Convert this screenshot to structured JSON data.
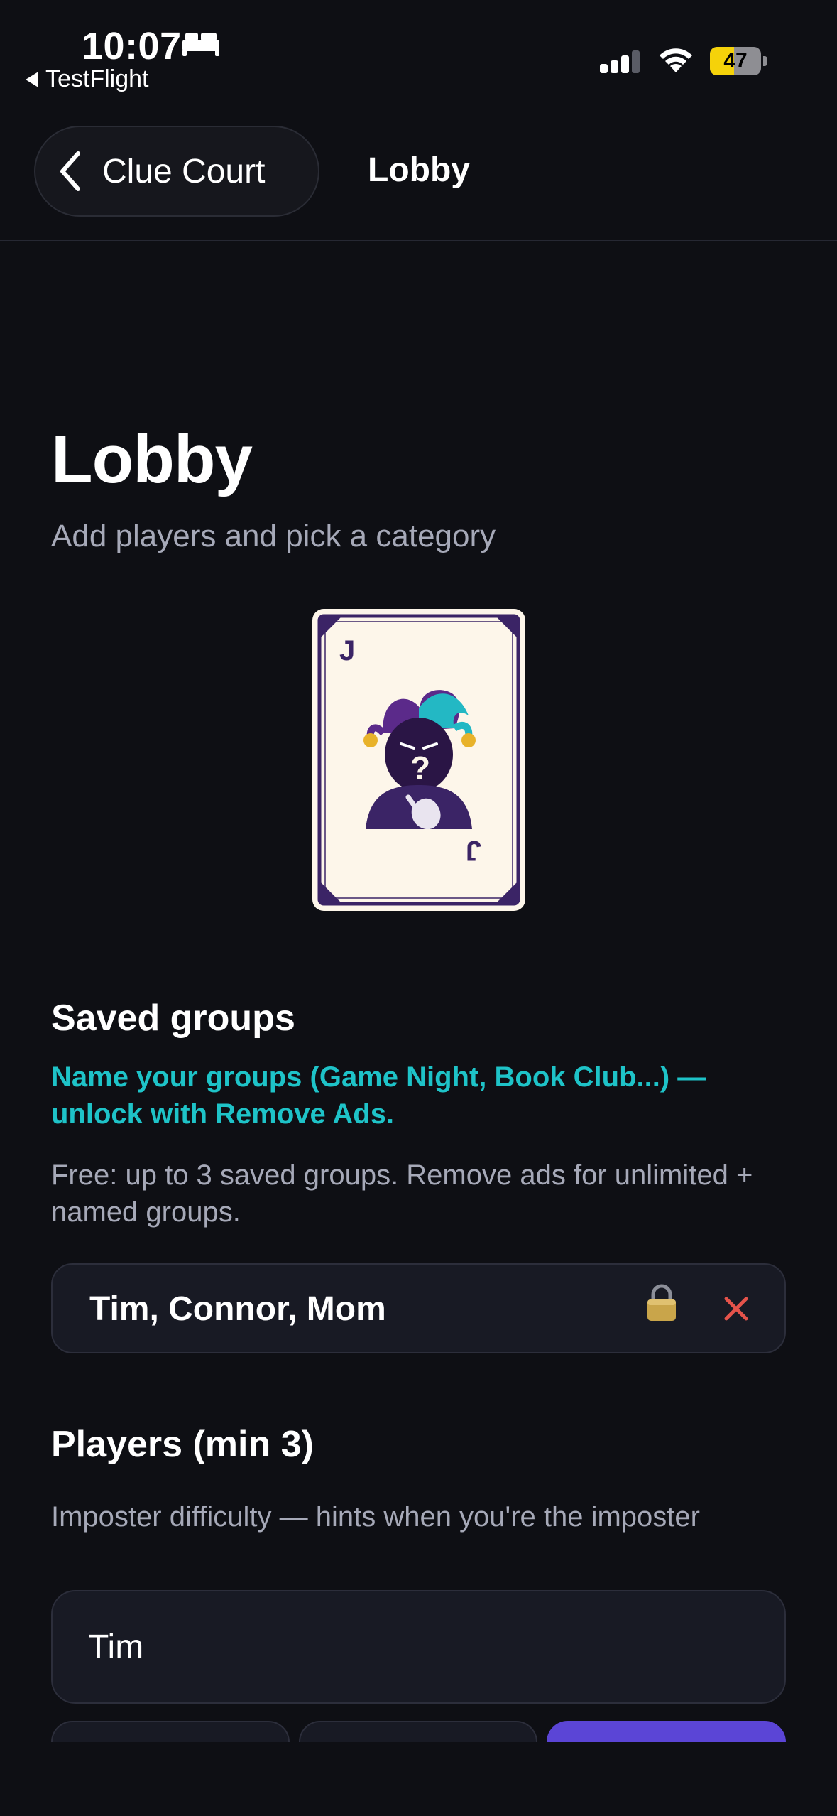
{
  "status_bar": {
    "time": "10:07",
    "back_app": "TestFlight",
    "battery": "47",
    "battery_level": 0.47,
    "icons": [
      "bed-icon",
      "cellular-signal-icon",
      "wifi-icon",
      "battery-icon"
    ]
  },
  "nav": {
    "back_label": "Clue Court",
    "title": "Lobby"
  },
  "header": {
    "title": "Lobby",
    "subtitle": "Add players and pick a category"
  },
  "card": {
    "rank": "J"
  },
  "saved_groups": {
    "heading": "Saved groups",
    "promo": "Name your groups (Game Night, Book Club...) — unlock with Remove Ads.",
    "note": "Free: up to 3 saved groups. Remove ads for unlimited + named groups.",
    "groups": [
      {
        "name": "Tim, Connor, Mom"
      }
    ]
  },
  "players": {
    "heading": "Players (min 3)",
    "difficulty_label": "Imposter difficulty — hints when you're the imposter",
    "input_value": "Tim"
  },
  "colors": {
    "background": "#0e0f14",
    "accent_teal": "#1ec3c8",
    "accent_purple": "#5b45d6",
    "danger": "#e5534b",
    "muted_text": "#a6a9b8"
  }
}
